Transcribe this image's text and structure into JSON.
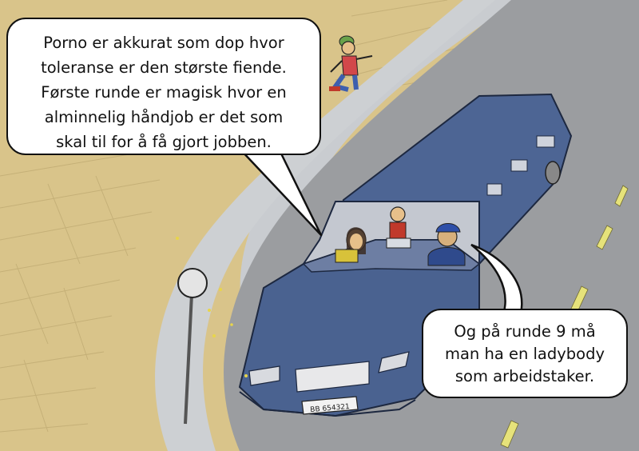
{
  "speech": {
    "left": {
      "lines": [
        "Porno er akkurat som dop hvor",
        "toleranse er den største fiende.",
        "Første runde er magisk hvor en",
        "alminnelig håndjob er det som",
        "skal til for å få gjort jobben."
      ]
    },
    "right": {
      "lines": [
        "Og på runde 9 må",
        "man ha en ladybody",
        "som arbeidstaker."
      ]
    }
  },
  "car": {
    "license_plate": "BB 654321",
    "color": "#4a6290"
  },
  "colors": {
    "field": "#d9c48a",
    "road": "#9b9da0",
    "path": "#cdd0d3",
    "lane_marking": "#e6e27a"
  }
}
